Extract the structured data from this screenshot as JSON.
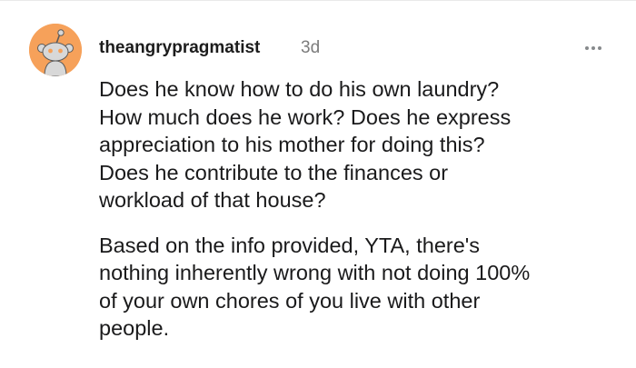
{
  "comment": {
    "author": "theangrypragmatist",
    "age": "3d",
    "more_icon": "more-horizontal-icon",
    "avatar_icon": "snoo-avatar-icon",
    "avatar_color": "#f6a15a",
    "paragraphs": [
      "Does he know how to do his own laundry?\nHow much does he work? Does he express\nappreciation to his mother for doing this?\nDoes he contribute to the finances or\nworkload of that house?",
      "Based on the info provided, YTA, there's\nnothing inherently wrong with not doing 100%\nof your own chores of you live with other\npeople."
    ]
  }
}
